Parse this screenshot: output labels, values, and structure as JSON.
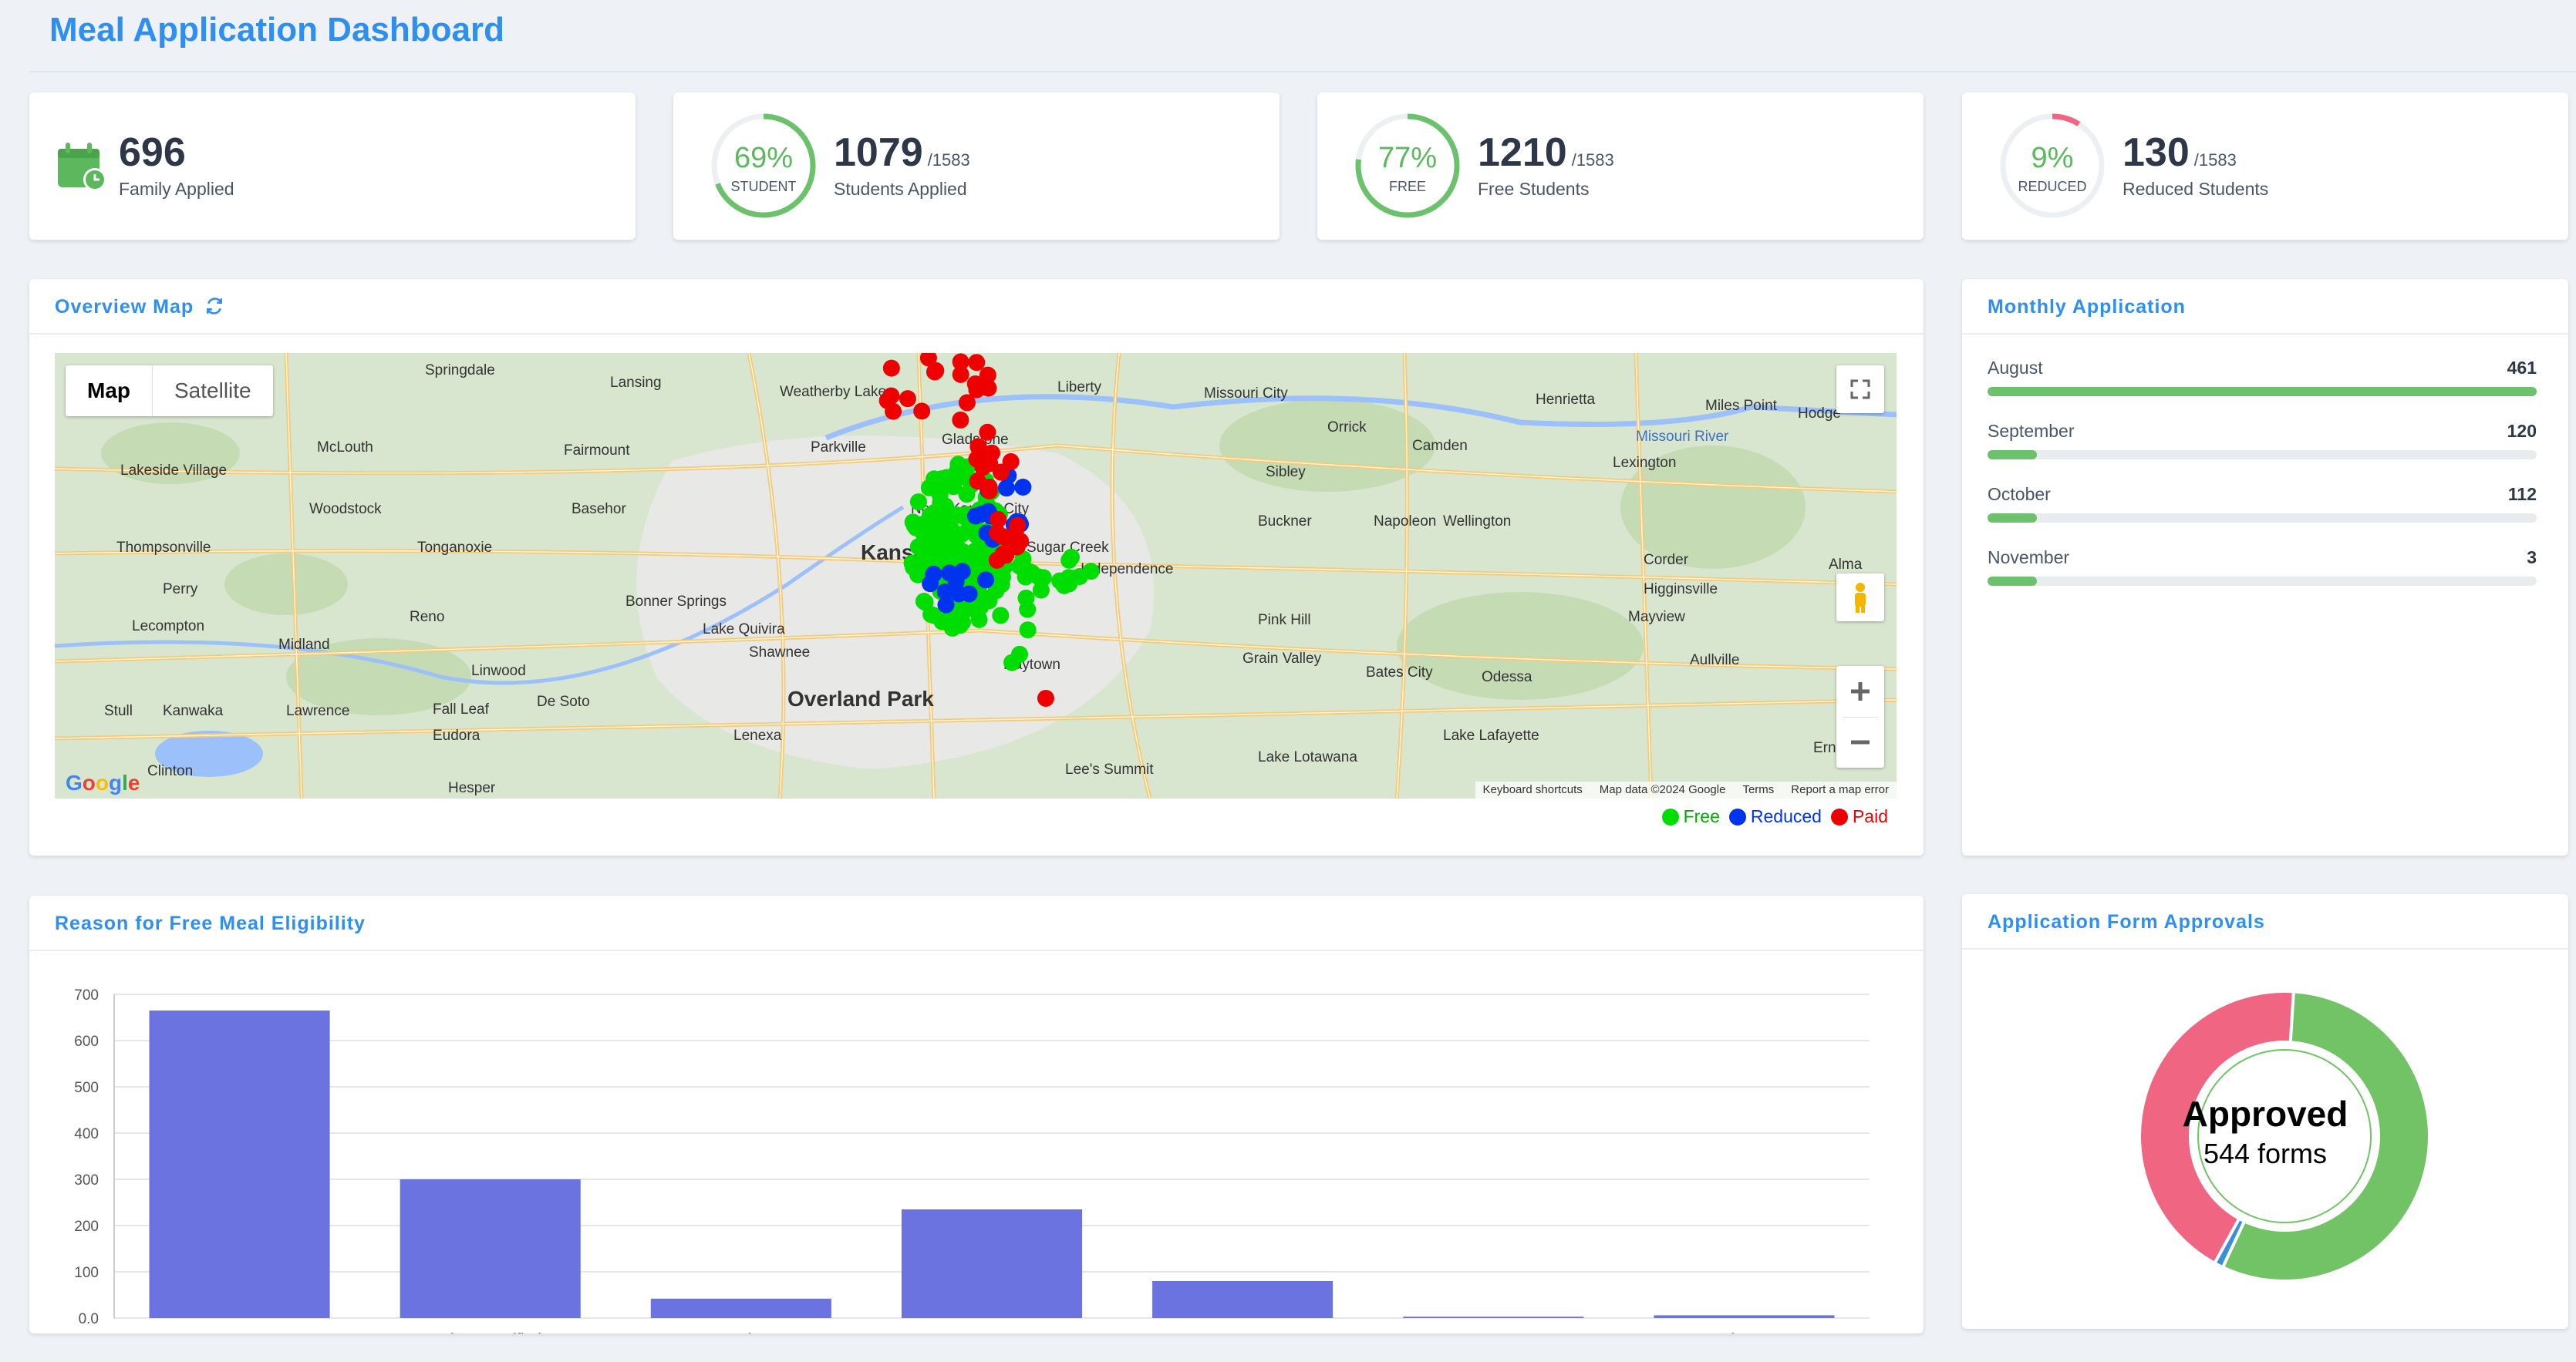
{
  "page": {
    "title": "Meal Application Dashboard"
  },
  "stats": {
    "family": {
      "value": "696",
      "label": "Family Applied",
      "icon": "calendar-clock-icon"
    },
    "students": {
      "pct": "69%",
      "sub": "STUDENT",
      "value": "1079",
      "total": "/1583",
      "label": "Students Applied",
      "fraction": 0.69
    },
    "free": {
      "pct": "77%",
      "sub": "FREE",
      "value": "1210",
      "total": "/1583",
      "label": "Free Students",
      "fraction": 0.77
    },
    "reduced": {
      "pct": "9%",
      "sub": "REDUCED",
      "value": "130",
      "total": "/1583",
      "label": "Reduced Students",
      "fraction": 0.09
    }
  },
  "map_card": {
    "title": "Overview Map",
    "refresh_icon": "refresh-icon",
    "toggle": {
      "map": "Map",
      "satellite": "Satellite"
    },
    "footer": {
      "shortcuts": "Keyboard shortcuts",
      "data": "Map data ©2024 Google",
      "terms": "Terms",
      "report": "Report a map error"
    },
    "logo": "Google",
    "places": [
      "Springdale",
      "Lansing",
      "Weatherby Lake",
      "Liberty",
      "Missouri City",
      "Henrietta",
      "Miles Point",
      "Hodge",
      "McLouth",
      "Fairmount",
      "Parkville",
      "Gladstone",
      "Orrick",
      "Camden",
      "Lexington",
      "Lakeside Village",
      "Woodstock",
      "Basehor",
      "North Kansas City",
      "Sibley",
      "Thompsonville",
      "Tonganoxie",
      "Kansas City",
      "Sugar Creek",
      "Independence",
      "Buckner",
      "Napoleon",
      "Wellington",
      "Corder",
      "Alma",
      "Perry",
      "Bonner Springs",
      "Higginsville",
      "Lecompton",
      "Reno",
      "Lake Quivira",
      "Pink Hill",
      "Mayview",
      "Midland",
      "Shawnee",
      "Grain Valley",
      "Aullville",
      "Linwood",
      "Raytown",
      "Bates City",
      "Odessa",
      "Stull",
      "Kanwaka",
      "Lawrence",
      "Fall Leaf",
      "De Soto",
      "Overland Park",
      "Eudora",
      "Lenexa",
      "Lake Lafayette",
      "Ernestville",
      "Clinton",
      "Hesper",
      "Lee's Summit",
      "Lake Lotawana",
      "Missouri River"
    ],
    "legend": [
      {
        "label": "Free",
        "color": "#00dd00"
      },
      {
        "label": "Reduced",
        "color": "#0033ee"
      },
      {
        "label": "Paid",
        "color": "#ee0000"
      }
    ]
  },
  "monthly": {
    "title": "Monthly Application",
    "items": [
      {
        "month": "August",
        "value": "461",
        "fraction": 1.0
      },
      {
        "month": "September",
        "value": "120",
        "fraction": 0.09
      },
      {
        "month": "October",
        "value": "112",
        "fraction": 0.09
      },
      {
        "month": "November",
        "value": "3",
        "fraction": 0.09
      }
    ]
  },
  "eligibility": {
    "title": "Reason for Free Meal Eligibility"
  },
  "chart_data": {
    "type": "bar",
    "categories": [
      "Income",
      "Direct Certified",
      "Homeless",
      "CEP",
      "SNAP",
      "FDPIR",
      "Migrant"
    ],
    "values": [
      665,
      300,
      42,
      235,
      80,
      3,
      6
    ],
    "ylim": [
      0,
      700
    ],
    "yticks": [
      "0.0",
      "100",
      "200",
      "300",
      "400",
      "500",
      "600",
      "700"
    ],
    "grid": true,
    "color": "#6b73e0"
  },
  "approvals": {
    "title": "Application Form Approvals",
    "center_title": "Approved",
    "center_sub": "544 forms",
    "segments": [
      {
        "fraction": 0.56,
        "color": "#72c266"
      },
      {
        "fraction": 0.01,
        "color": "#3b8fd9"
      },
      {
        "fraction": 0.43,
        "color": "#f06581"
      }
    ]
  }
}
